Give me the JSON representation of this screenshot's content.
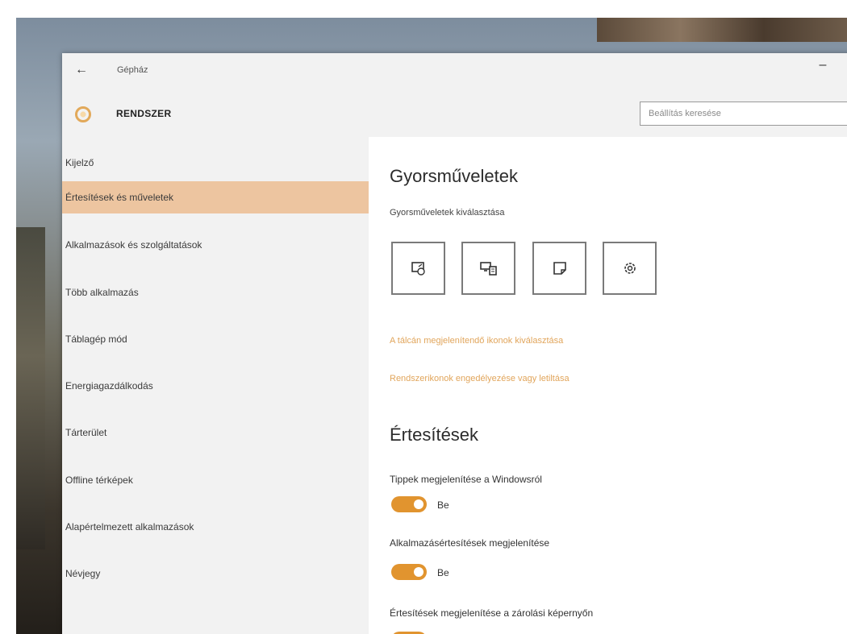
{
  "window": {
    "title": "Gépház",
    "minimize_glyph": "–"
  },
  "header": {
    "title": "RENDSZER",
    "icon": "gear-icon"
  },
  "search": {
    "placeholder": "Beállítás keresése"
  },
  "sidebar": {
    "items": [
      {
        "label": "Kijelző"
      },
      {
        "label": "Értesítések és műveletek"
      },
      {
        "label": "Alkalmazások és szolgáltatások"
      },
      {
        "label": "Több alkalmazás"
      },
      {
        "label": "Táblagép mód"
      },
      {
        "label": "Energiagazdálkodás"
      },
      {
        "label": "Tárterület"
      },
      {
        "label": "Offline térképek"
      },
      {
        "label": "Alapértelmezett alkalmazások"
      },
      {
        "label": "Névjegy"
      }
    ],
    "active_index": 1
  },
  "main": {
    "quick_actions": {
      "heading": "Gyorsműveletek",
      "subheading": "Gyorsműveletek kiválasztása",
      "buttons": [
        {
          "icon": "tablet-mode-icon"
        },
        {
          "icon": "connect-icon"
        },
        {
          "icon": "note-icon"
        },
        {
          "icon": "settings-icon"
        }
      ],
      "link_taskbar_icons": "A tálcán megjelenítendő ikonok kiválasztása",
      "link_system_icons": "Rendszerikonok engedélyezése vagy letiltása"
    },
    "notifications": {
      "heading": "Értesítések",
      "settings": [
        {
          "label": "Tippek megjelenítése a Windowsról",
          "state": "Be"
        },
        {
          "label": "Alkalmazásértesítések megjelenítése",
          "state": "Be"
        },
        {
          "label": "Értesítések megjelenítése a zárolási képernyőn",
          "state": "Be"
        }
      ]
    }
  },
  "colors": {
    "accent": "#e1942f",
    "active_nav": "#edc5a0",
    "link": "#e1a55b"
  }
}
